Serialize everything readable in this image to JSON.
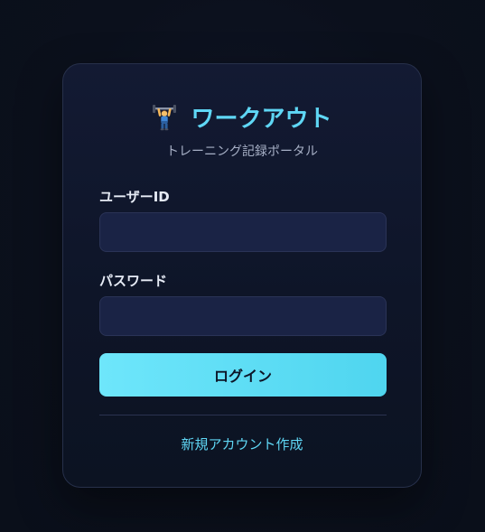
{
  "brand": {
    "icon": "weightlifter-icon",
    "title": "ワークアウト",
    "subtitle": "トレーニング記録ポータル"
  },
  "form": {
    "user_id_label": "ユーザーID",
    "user_id_value": "",
    "password_label": "パスワード",
    "password_value": "",
    "login_label": "ログイン"
  },
  "footer": {
    "signup_link": "新規アカウント作成"
  },
  "colors": {
    "accent": "#5fd7f5",
    "button_gradient_start": "#6ee6fb",
    "button_gradient_end": "#4fd5ef",
    "card_background": "#111830",
    "input_background": "#1a2345",
    "page_background": "#0b101c"
  }
}
